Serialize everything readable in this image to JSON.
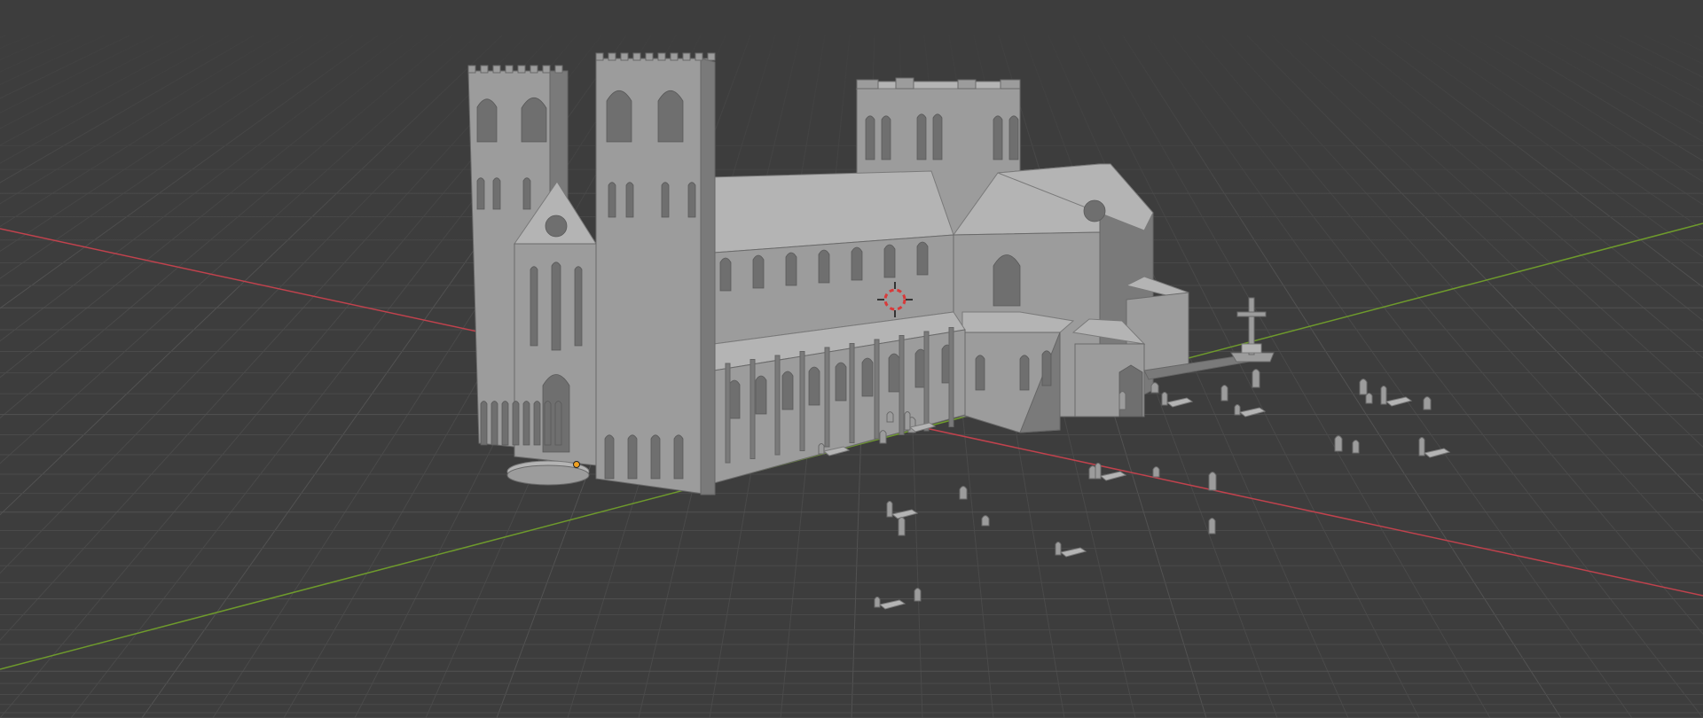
{
  "app": {
    "name": "",
    "view": "3d-viewport"
  },
  "viewport": {
    "background_color": "#3d3d3d",
    "grid_line_color": "#4a4a4a",
    "grid_major_color": "#525252",
    "x_axis_color": "#c0424d",
    "y_axis_color": "#6e9a2c",
    "model_color": "#9c9c9c",
    "model_shadow_color": "#7a7a7a",
    "model_highlight_color": "#b4b4b4",
    "origin_marker_color": "#f0a020",
    "cursor_color": "#d83a3a"
  },
  "scene": {
    "objects": [
      {
        "name": "cathedral",
        "icon": "cathedral-model"
      },
      {
        "name": "churchyard-cross",
        "icon": "cross-monument"
      },
      {
        "name": "gravestones",
        "icon": "gravestone",
        "count": 22
      }
    ],
    "cursor": {
      "icon": "3d-cursor-icon"
    },
    "origin": {
      "icon": "origin-point-icon"
    }
  }
}
